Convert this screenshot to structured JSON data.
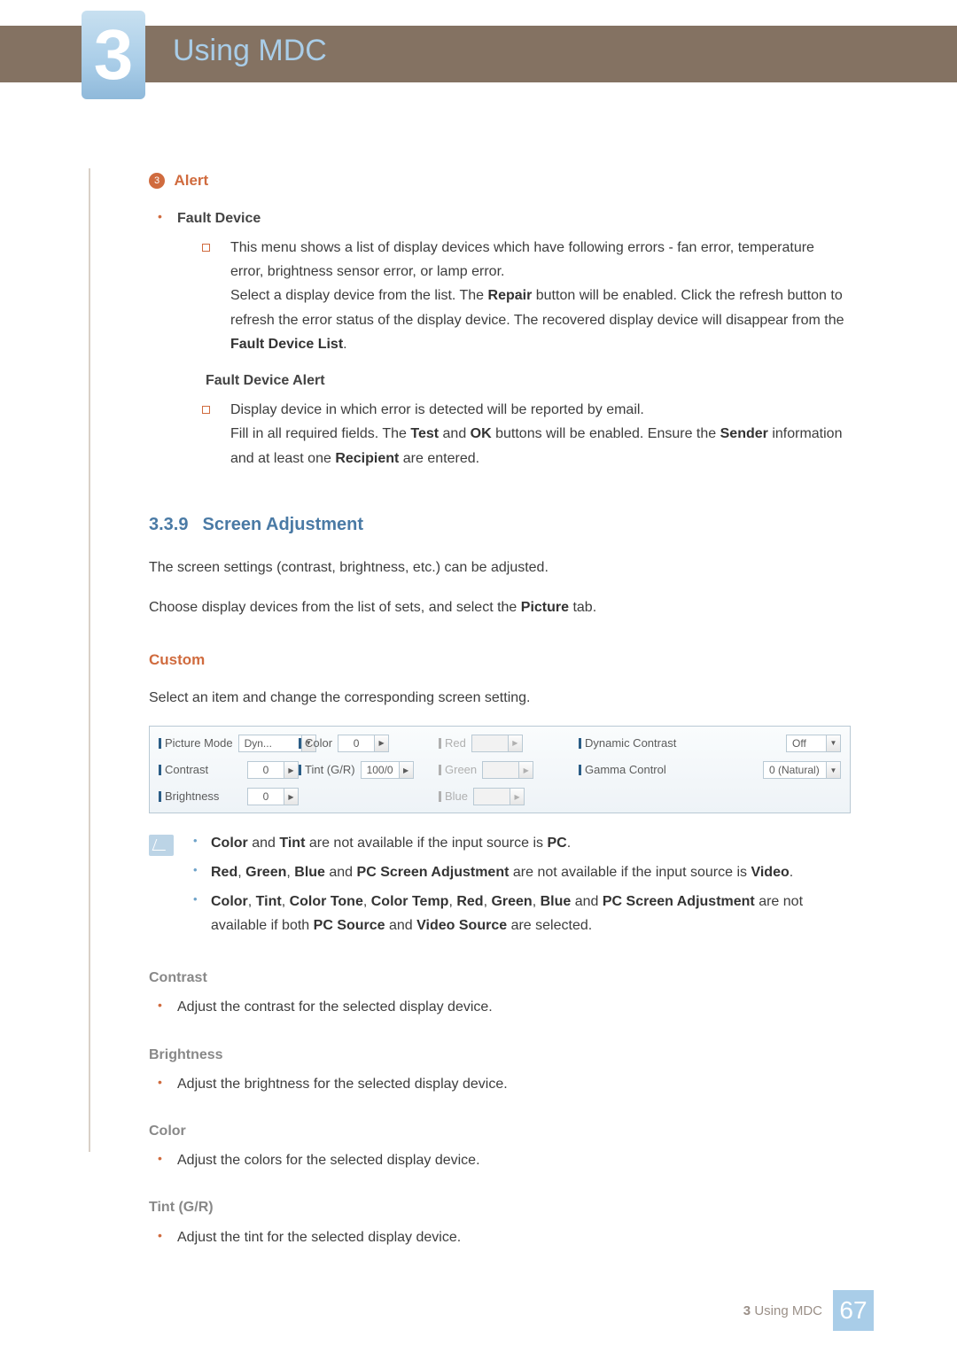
{
  "chapter": {
    "number": "3",
    "title": "Using MDC"
  },
  "alert": {
    "badge": "3",
    "title": "Alert",
    "fault_device": {
      "heading": "Fault Device",
      "p1a": "This menu shows a list of display devices which have following errors - fan error, temperature error, brightness sensor error, or lamp error.",
      "p1b_pre": "Select a display device from the list. The ",
      "p1b_bold1": "Repair",
      "p1b_mid": " button will be enabled. Click the refresh button to refresh the error status of the display device. The recovered display device will disappear from the ",
      "p1b_bold2": "Fault Device List",
      "p1b_suf": "."
    },
    "fault_device_alert": {
      "heading": "Fault Device Alert",
      "p1": "Display device in which error is detected will be reported by email.",
      "p2_pre": "Fill in all required fields. The ",
      "p2_b1": "Test",
      "p2_mid1": " and ",
      "p2_b2": "OK",
      "p2_mid2": " buttons will be enabled. Ensure the ",
      "p2_b3": "Sender",
      "p2_mid3": " information and at least one ",
      "p2_b4": "Recipient",
      "p2_suf": " are entered."
    }
  },
  "section": {
    "number": "3.3.9",
    "title": "Screen Adjustment",
    "p1": "The screen settings (contrast, brightness, etc.) can be adjusted.",
    "p2_pre": "Choose display devices from the list of sets, and select the ",
    "p2_b": "Picture",
    "p2_suf": " tab."
  },
  "custom": {
    "heading": "Custom",
    "p": "Select an item and change the corresponding screen setting."
  },
  "panel": {
    "picture_mode": {
      "label": "Picture Mode",
      "value": "Dyn..."
    },
    "color": {
      "label": "Color",
      "value": "0"
    },
    "red": {
      "label": "Red",
      "value": ""
    },
    "dynamic_contrast": {
      "label": "Dynamic Contrast",
      "value": "Off"
    },
    "contrast": {
      "label": "Contrast",
      "value": "0"
    },
    "tint": {
      "label": "Tint (G/R)",
      "value": "100/0"
    },
    "green": {
      "label": "Green",
      "value": ""
    },
    "gamma": {
      "label": "Gamma Control",
      "value": "0 (Natural)"
    },
    "brightness": {
      "label": "Brightness",
      "value": "0"
    },
    "blue": {
      "label": "Blue",
      "value": ""
    }
  },
  "notes": {
    "n1_b1": "Color",
    "n1_m1": " and ",
    "n1_b2": "Tint",
    "n1_m2": " are not available if the input source is ",
    "n1_b3": "PC",
    "n1_suf": ".",
    "n2_b1": "Red",
    "n2_c1": ", ",
    "n2_b2": "Green",
    "n2_c2": ", ",
    "n2_b3": "Blue",
    "n2_m1": " and ",
    "n2_b4": "PC Screen Adjustment",
    "n2_m2": " are not available if the input source is ",
    "n2_b5": "Video",
    "n2_suf": ".",
    "n3_b1": "Color",
    "n3_c1": ", ",
    "n3_b2": "Tint",
    "n3_c2": ", ",
    "n3_b3": "Color Tone",
    "n3_c3": ", ",
    "n3_b4": "Color Temp",
    "n3_c4": ", ",
    "n3_b5": "Red",
    "n3_c5": ", ",
    "n3_b6": "Green",
    "n3_c6": ", ",
    "n3_b7": "Blue",
    "n3_m1": " and ",
    "n3_b8": "PC Screen Adjustment",
    "n3_m2": " are not available if both ",
    "n3_b9": "PC Source",
    "n3_m3": " and ",
    "n3_b10": "Video Source",
    "n3_suf": " are selected."
  },
  "properties": {
    "contrast": {
      "h": "Contrast",
      "p": "Adjust the contrast for the selected display device."
    },
    "brightness": {
      "h": "Brightness",
      "p": "Adjust the brightness for the selected display device."
    },
    "color": {
      "h": "Color",
      "p": "Adjust the colors for the selected display device."
    },
    "tint": {
      "h": "Tint (G/R)",
      "p": "Adjust the tint for the selected display device."
    }
  },
  "footer": {
    "chapter_num": "3",
    "title": "Using MDC",
    "page": "67"
  }
}
